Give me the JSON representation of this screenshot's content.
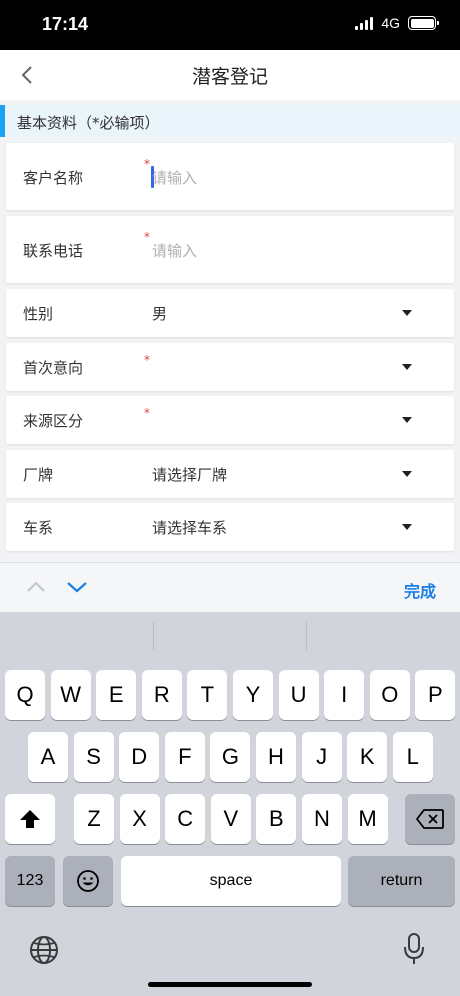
{
  "status": {
    "time": "17:14",
    "network": "4G"
  },
  "nav": {
    "title": "潜客登记"
  },
  "section": {
    "title": "基本资料（*必输项）"
  },
  "form": [
    {
      "label": "客户名称",
      "required": true,
      "value": "请输入",
      "placeholder": true,
      "type": "input"
    },
    {
      "label": "联系电话",
      "required": true,
      "value": "请输入",
      "placeholder": true,
      "type": "input"
    },
    {
      "label": "性别",
      "required": false,
      "value": "男",
      "placeholder": false,
      "type": "select"
    },
    {
      "label": "首次意向",
      "required": true,
      "value": "",
      "placeholder": false,
      "type": "select"
    },
    {
      "label": "来源区分",
      "required": true,
      "value": "",
      "placeholder": false,
      "type": "select"
    },
    {
      "label": "厂牌",
      "required": false,
      "value": "请选择厂牌",
      "placeholder": false,
      "type": "select"
    },
    {
      "label": "车系",
      "required": false,
      "value": "请选择车系",
      "placeholder": false,
      "type": "select"
    }
  ],
  "required_mark": "*",
  "toolbar": {
    "done": "完成"
  },
  "keyboard": {
    "row1": [
      "Q",
      "W",
      "E",
      "R",
      "T",
      "Y",
      "U",
      "I",
      "O",
      "P"
    ],
    "row2": [
      "A",
      "S",
      "D",
      "F",
      "G",
      "H",
      "J",
      "K",
      "L"
    ],
    "row3": [
      "Z",
      "X",
      "C",
      "V",
      "B",
      "N",
      "M"
    ],
    "numbers": "123",
    "space": "space",
    "return": "return"
  }
}
